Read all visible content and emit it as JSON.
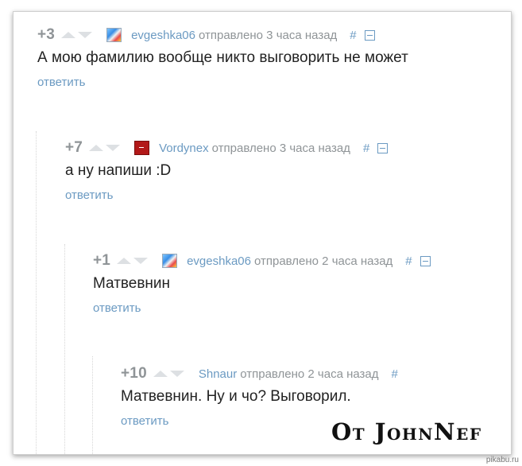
{
  "comments": [
    {
      "rating": "+3",
      "username": "evgeshka06",
      "time": "отправлено 3 часа назад",
      "hash": "#",
      "text": "А мою фамилию вообще никто выговорить не может",
      "reply": "ответить",
      "avatar_icon": "pony-avatar-icon"
    },
    {
      "rating": "+7",
      "username": "Vordynex",
      "time": "отправлено 3 часа назад",
      "hash": "#",
      "text": "а ну напиши :D",
      "reply": "ответить",
      "avatar_icon": "red-avatar-icon"
    },
    {
      "rating": "+1",
      "username": "evgeshka06",
      "time": "отправлено 2 часа назад",
      "hash": "#",
      "text": "Матвевнин",
      "reply": "ответить",
      "avatar_icon": "pony-avatar-icon"
    },
    {
      "rating": "+10",
      "username": "Shnaur",
      "time": "отправлено 2 часа назад",
      "hash": "#",
      "text": "Матвевнин. Ну и чо? Выговорил.",
      "reply": "ответить",
      "avatar_icon": "none"
    }
  ],
  "watermark": "От JohnNef",
  "site": "pikabu.ru",
  "colors": {
    "link": "#6b9ac2",
    "muted": "#8f9497",
    "arrow": "#dde0e3",
    "text": "#222222"
  }
}
